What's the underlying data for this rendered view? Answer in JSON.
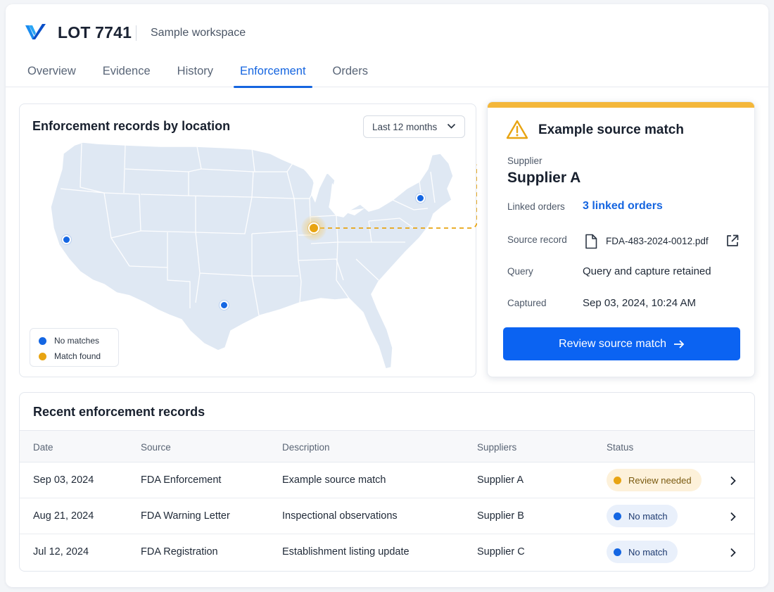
{
  "header": {
    "lot_title": "LOT 7741",
    "workspace": "Sample workspace",
    "tabs": [
      {
        "label": "Overview"
      },
      {
        "label": "Evidence"
      },
      {
        "label": "History"
      },
      {
        "label": "Enforcement",
        "active": true
      },
      {
        "label": "Orders"
      }
    ]
  },
  "map": {
    "title": "Enforcement records by location",
    "range_select": "Last 12 months",
    "legend": [
      {
        "label": "No matches",
        "color": "#1466e3"
      },
      {
        "label": "Match found",
        "color": "#e8a412"
      }
    ],
    "markers": [
      {
        "location": "California",
        "status": "No matches"
      },
      {
        "location": "Texas",
        "status": "No matches"
      },
      {
        "location": "Massachusetts",
        "status": "No matches"
      },
      {
        "location": "Indiana",
        "status": "Match found"
      }
    ]
  },
  "detail": {
    "title": "Example source match",
    "supplier_label": "Supplier",
    "supplier_name": "Supplier A",
    "linked_orders_label": "Linked orders",
    "linked_orders_value": "3 linked orders",
    "source_record_label": "Source record",
    "source_record_value": "FDA-483-2024-0012.pdf",
    "query_label": "Query",
    "query_value": "Query and capture retained",
    "captured_label": "Captured",
    "captured_value": "Sep 03, 2024, 10:24 AM",
    "button_label": "Review source match",
    "accent_color": "#f4b73a"
  },
  "table": {
    "title": "Recent enforcement records",
    "columns": [
      "Date",
      "Source",
      "Description",
      "Suppliers",
      "Status"
    ],
    "rows": [
      {
        "date": "Sep 03, 2024",
        "source": "FDA Enforcement",
        "description": "Example source match",
        "supplier": "Supplier A",
        "status": "Review needed"
      },
      {
        "date": "Aug 21, 2024",
        "source": "FDA Warning Letter",
        "description": "Inspectional observations",
        "supplier": "Supplier B",
        "status": "No match"
      },
      {
        "date": "Jul 12, 2024",
        "source": "FDA Registration",
        "description": "Establishment listing update",
        "supplier": "Supplier C",
        "status": "No match"
      }
    ]
  },
  "colors": {
    "brand_blue": "#1565e0",
    "primary_button": "#0b63f2",
    "warning": "#e8a412",
    "map_fill": "#dfe8f3"
  }
}
